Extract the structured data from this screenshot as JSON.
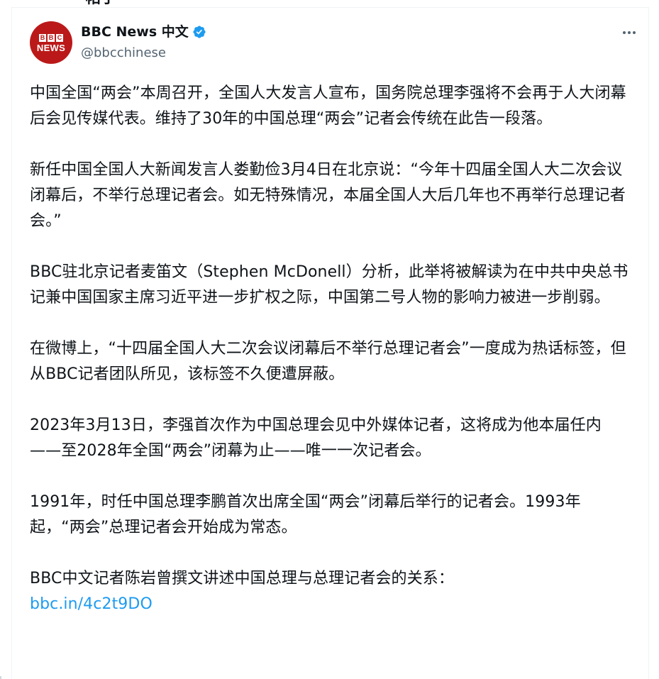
{
  "top_cut_title": "帖子",
  "author": {
    "display_name": "BBC News 中文",
    "handle": "@bbcchinese",
    "avatar": {
      "letters": [
        "B",
        "B",
        "C"
      ],
      "word": "NEWS",
      "bg_color": "#bb1919"
    },
    "verified_badge": "verified-badge-icon"
  },
  "more_menu_icon": "more-horizontal-icon",
  "paragraphs": [
    "中国全国“两会”本周召开，全国人大发言人宣布，国务院总理李强将不会再于人大闭幕后会见传媒代表。维持了30年的中国总理“两会”记者会传统在此告一段落。",
    "新任中国全国人大新闻发言人娄勤俭3月4日在北京说：“今年十四届全国人大二次会议闭幕后，不举行总理记者会。如无特殊情况，本届全国人大后几年也不再举行总理记者会。”",
    "BBC驻北京记者麦笛文（Stephen McDonell）分析，此举将被解读为在中共中央总书记兼中国国家主席习近平进一步扩权之际，中国第二号人物的影响力被进一步削弱。",
    "在微博上，“十四届全国人大二次会议闭幕后不举行总理记者会”一度成为热话标签，但从BBC记者团队所见，该标签不久便遭屏蔽。",
    "2023年3月13日，李强首次作为中国总理会见中外媒体记者，这将成为他本届任内——至2028年全国“两会”闭幕为止——唯一一次记者会。",
    "1991年，时任中国总理李鹏首次出席全国“两会”闭幕后举行的记者会。1993年起，“两会”总理记者会开始成为常态。"
  ],
  "final_paragraph": {
    "text": "BBC中文记者陈岩曾撰文讲述中国总理与总理记者会的关系：",
    "link_text": "bbc.in/4c2t9DO"
  },
  "colors": {
    "text": "#0f1419",
    "secondary": "#536471",
    "link": "#1d9bf0",
    "verified": "#1d9bf0",
    "bbc_red": "#bb1919"
  }
}
